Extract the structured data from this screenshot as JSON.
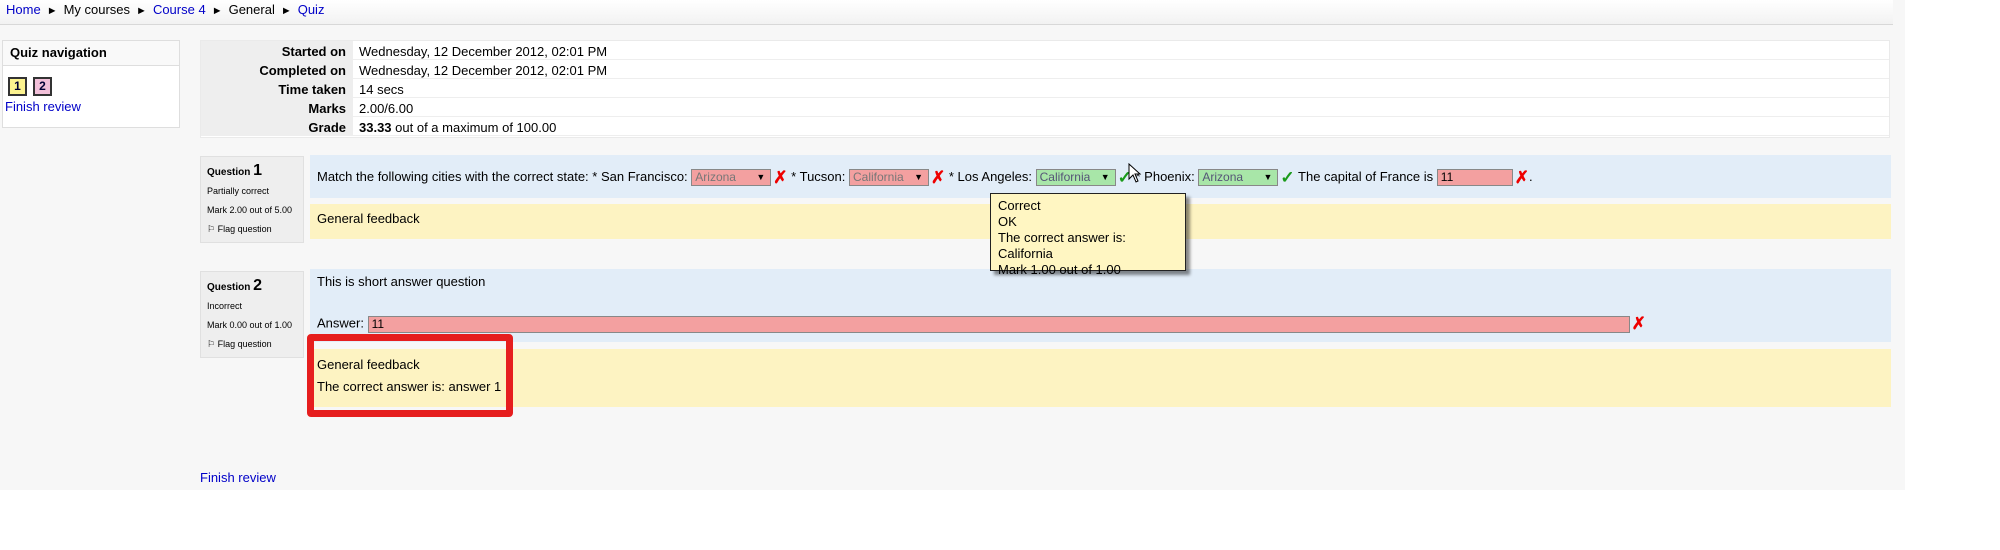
{
  "breadcrumb": {
    "items": [
      {
        "label": "Home",
        "link": true
      },
      {
        "label": "My courses",
        "link": false
      },
      {
        "label": "Course 4",
        "link": true
      },
      {
        "label": "General",
        "link": false
      },
      {
        "label": "Quiz",
        "link": true
      }
    ],
    "separator": "►"
  },
  "quiz_nav": {
    "title": "Quiz navigation",
    "buttons": [
      "1",
      "2"
    ],
    "finish_label": "Finish review"
  },
  "summary": {
    "rows": [
      {
        "label": "Started on",
        "value": "Wednesday, 12 December 2012, 02:01 PM"
      },
      {
        "label": "Completed on",
        "value": "Wednesday, 12 December 2012, 02:01 PM"
      },
      {
        "label": "Time taken",
        "value": "14 secs"
      },
      {
        "label": "Marks",
        "value": "2.00/6.00"
      },
      {
        "label": "Grade",
        "value_bold": "33.33",
        "value_rest": " out of a maximum of 100.00"
      }
    ]
  },
  "question1": {
    "label": "Question",
    "number": "1",
    "state": "Partially correct",
    "mark": "Mark 2.00 out of 5.00",
    "flag": "Flag question",
    "prompt": "Match the following cities with the correct state: * San Francisco:",
    "sf_choice": "Arizona",
    "tucson_label": "* Tucson:",
    "tucson_choice": "California",
    "la_label": "* Los Angeles:",
    "la_choice": "California",
    "phoenix_label": "* Phoenix:",
    "phoenix_choice": "Arizona",
    "france_label": "The capital of France is",
    "france_value": "11",
    "period": ".",
    "general_feedback": "General feedback"
  },
  "tooltip": {
    "line1": "Correct",
    "line2": "OK",
    "line3": "The correct answer is: California",
    "line4": "Mark 1.00 out of 1.00"
  },
  "question2": {
    "label": "Question",
    "number": "2",
    "state": "Incorrect",
    "mark": "Mark 0.00 out of 1.00",
    "flag": "Flag question",
    "prompt": "This is short answer question",
    "answer_label": "Answer:",
    "answer_value": "11",
    "general_feedback": "General feedback",
    "correct_answer": "The correct answer is: answer 1"
  },
  "footer": {
    "finish_label": "Finish review"
  },
  "icons": {
    "cross": "✗",
    "tick": "✓",
    "arrow": "▼",
    "flag": "flag-icon",
    "cursor": "mouse-cursor-icon"
  },
  "colors": {
    "incorrect": "#f3a0a0",
    "correct": "#a8e6a8",
    "feedback": "#fdf3c2",
    "formulation": "#e2edf8",
    "highlight": "#e61e1e"
  }
}
